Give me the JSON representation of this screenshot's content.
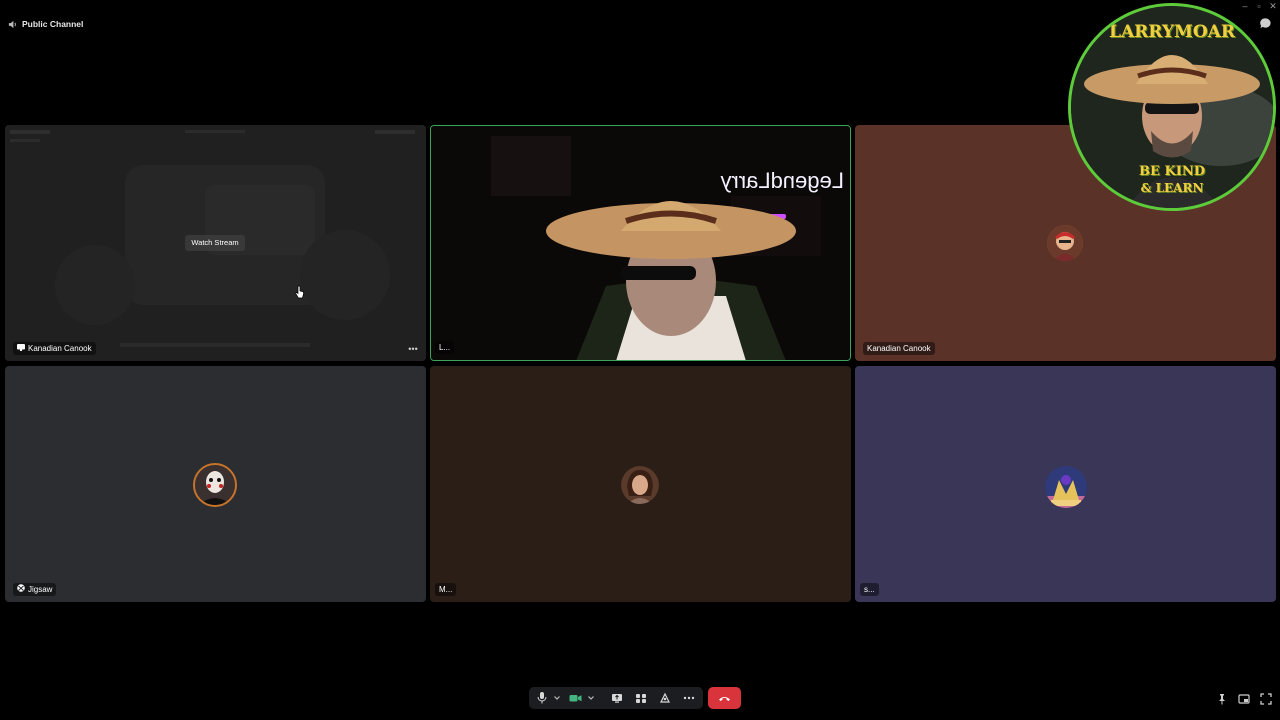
{
  "window": {
    "channel_name": "Public Channel"
  },
  "tiles": [
    {
      "name": "Kanadian Canook",
      "type": "stream",
      "action_label": "Watch Stream",
      "bg": "#202020"
    },
    {
      "name": "L...",
      "type": "camera",
      "speaking": true,
      "bg": "#0b0808",
      "sign_text": "LegendLarry"
    },
    {
      "name": "Kanadian Canook",
      "type": "avatar",
      "bg": "#5a3228"
    },
    {
      "name": "Jigsaw",
      "type": "avatar",
      "bg": "#2b2d31"
    },
    {
      "name": "M...",
      "type": "avatar",
      "bg": "#2a1e17"
    },
    {
      "name": "s...",
      "type": "avatar",
      "bg": "#393658"
    }
  ],
  "overlay_logo": {
    "top_text": "LARRYMOAR",
    "bottom_text_1": "BE KIND",
    "bottom_text_2": "& LEARN"
  },
  "controls": {
    "icons": [
      "microphone-icon",
      "chevron-down-icon",
      "camera-icon",
      "chevron-down-icon",
      "screen-share-icon",
      "activities-icon",
      "soundboard-icon",
      "more-icon",
      "end-call-icon"
    ],
    "accent_green": "#43b581",
    "end_call_color": "#d9333b",
    "speaking_border": "#3ba55d"
  },
  "corner_icons": [
    "pin-icon",
    "pop-out-icon",
    "fullscreen-icon"
  ]
}
